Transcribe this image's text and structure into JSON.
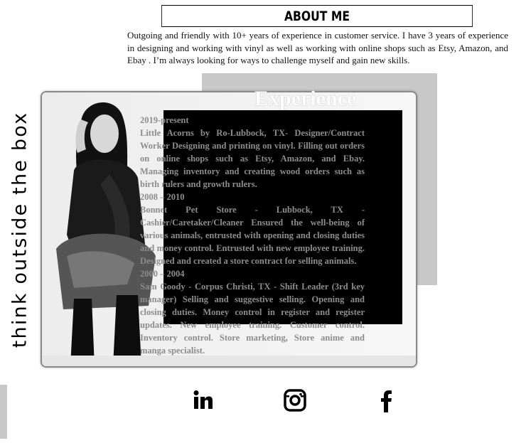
{
  "about": {
    "heading": "ABOUT ME",
    "text": "Outgoing and friendly with 10+ years of experience in customer service. I have 3 years of experience in designing and working with vinyl as well as working with online shops such as Etsy, Amazon, and Ebay . I’m always looking for ways to challenge myself and gain new skills."
  },
  "experience": {
    "title": "Experience",
    "jobs": [
      {
        "dates": "2019-present",
        "description": "Little Acorns by Ro-Lubbock, TX- Designer/Contract Worker Designing and printing on vinyl. Filling out orders on online shops such as Etsy, Amazon, and Ebay. Managing inventory and creating wood orders such as birth rulers and growth rulers."
      },
      {
        "dates": "2008 – 2010",
        "description": "Bonnet Pet Store - Lubbock, TX - Cashier/Caretaker/Cleaner Ensured the well-being of various animals, entrusted with opening and closing duties and money control. Entrusted with new employee training. Designed and created a store contract for selling animals."
      },
      {
        "dates": "2000 – 2004",
        "description": "Sam Goody - Corpus Christi, TX - Shift Leader (3rd key manager) Selling and suggestive selling. Opening and closing duties. Money control in register and register updates. New employee training. Customer control. Inventory control. Store marketing, Store anime and manga specialist."
      }
    ]
  },
  "sidebar": {
    "tagline": "think outside the box"
  },
  "social": {
    "linkedin_icon": "linkedin-icon",
    "instagram_icon": "instagram-icon",
    "facebook_icon": "facebook-icon"
  },
  "colors": {
    "panel": "#000000",
    "grey_block": "#c8c8c8",
    "experience_text": "#8c8c8c"
  }
}
